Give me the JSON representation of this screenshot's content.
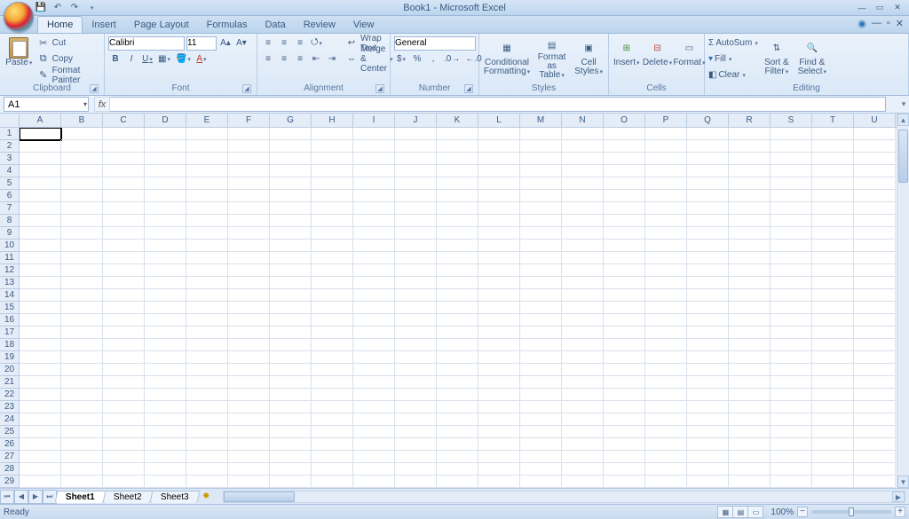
{
  "title": "Book1 - Microsoft Excel",
  "qat": {
    "save": "Save",
    "undo": "Undo",
    "redo": "Redo"
  },
  "tabs": [
    "Home",
    "Insert",
    "Page Layout",
    "Formulas",
    "Data",
    "Review",
    "View"
  ],
  "active_tab": "Home",
  "ribbon": {
    "clipboard": {
      "label": "Clipboard",
      "paste": "Paste",
      "cut": "Cut",
      "copy": "Copy",
      "format_painter": "Format Painter"
    },
    "font": {
      "label": "Font",
      "name": "Calibri",
      "size": "11",
      "bold": "B",
      "italic": "I",
      "underline": "U"
    },
    "alignment": {
      "label": "Alignment",
      "wrap": "Wrap Text",
      "merge": "Merge & Center"
    },
    "number": {
      "label": "Number",
      "format": "General"
    },
    "styles": {
      "label": "Styles",
      "conditional": "Conditional Formatting",
      "format_table": "Format as Table",
      "cell_styles": "Cell Styles"
    },
    "cells": {
      "label": "Cells",
      "insert": "Insert",
      "delete": "Delete",
      "format": "Format"
    },
    "editing": {
      "label": "Editing",
      "autosum": "AutoSum",
      "fill": "Fill",
      "clear": "Clear",
      "sort": "Sort & Filter",
      "find": "Find & Select"
    }
  },
  "namebox": "A1",
  "formula": "",
  "columns": [
    "A",
    "B",
    "C",
    "D",
    "E",
    "F",
    "G",
    "H",
    "I",
    "J",
    "K",
    "L",
    "M",
    "N",
    "O",
    "P",
    "Q",
    "R",
    "S",
    "T",
    "U"
  ],
  "row_count": 29,
  "sheets": [
    "Sheet1",
    "Sheet2",
    "Sheet3"
  ],
  "active_sheet": "Sheet1",
  "status": "Ready",
  "zoom": "100%"
}
